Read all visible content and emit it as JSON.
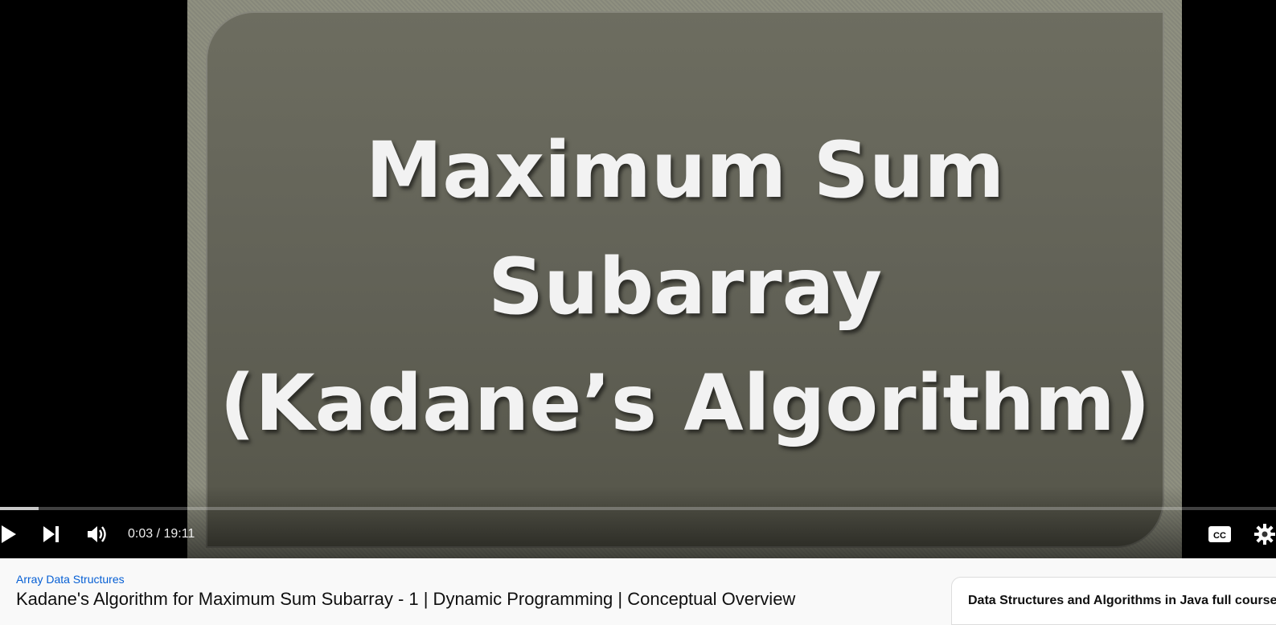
{
  "video": {
    "slide_lines": [
      "Maximum Sum",
      "Subarray",
      "(Kadane’s Algorithm)"
    ],
    "progress_fraction": 0.0026
  },
  "controls": {
    "current_time": "0:03",
    "duration": "19:11",
    "time_text": "0:03 / 19:11"
  },
  "below": {
    "category_link": "Array Data Structures",
    "video_title": "Kadane's Algorithm for Maximum Sum Subarray - 1 | Dynamic Programming | Conceptual Overview",
    "playlist_title": "Data Structures and Algorithms in Java full course"
  },
  "icons": {
    "play": "play-icon",
    "next": "next-icon",
    "volume": "volume-icon",
    "captions": "cc-icon",
    "settings": "gear-icon"
  }
}
